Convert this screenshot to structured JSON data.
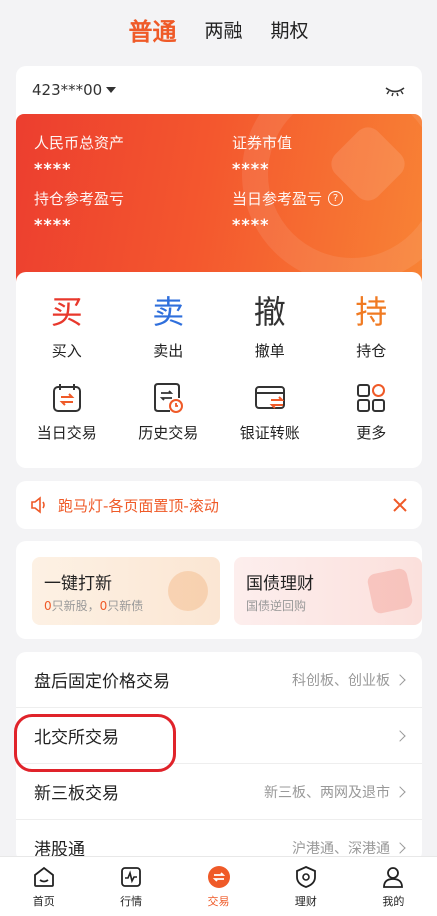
{
  "top_tabs": [
    "普通",
    "两融",
    "期权"
  ],
  "account": {
    "number": "423***00"
  },
  "assets": {
    "total_label": "人民币总资产",
    "total_value": "****",
    "market_label": "证券市值",
    "market_value": "****",
    "position_pl_label": "持仓参考盈亏",
    "position_pl_value": "****",
    "day_pl_label": "当日参考盈亏",
    "day_pl_value": "****",
    "help": "?"
  },
  "trade_buttons": [
    {
      "char": "买",
      "label": "买入",
      "color": "#e8382c"
    },
    {
      "char": "卖",
      "label": "卖出",
      "color": "#2f6fdc"
    },
    {
      "char": "撤",
      "label": "撤单",
      "color": "#333333"
    },
    {
      "char": "持",
      "label": "持仓",
      "color": "#f07a22"
    }
  ],
  "tools": [
    "当日交易",
    "历史交易",
    "银证转账",
    "更多"
  ],
  "marquee": {
    "text": "跑马灯-各页面置顶-滚动"
  },
  "promo": {
    "ipo": {
      "title": "一键打新",
      "count1": "0",
      "text1": "只新股，",
      "count2": "0",
      "text2": "只新债"
    },
    "bond": {
      "title": "国债理财",
      "sub": "国债逆回购"
    }
  },
  "list_items": [
    {
      "name": "盘后固定价格交易",
      "right": "科创板、创业板"
    },
    {
      "name": "北交所交易",
      "right": ""
    },
    {
      "name": "新三板交易",
      "right": "新三板、两网及退市"
    },
    {
      "name": "港股通",
      "right": "沪港通、深港通"
    }
  ],
  "bottom_tabs": [
    "首页",
    "行情",
    "交易",
    "理财",
    "我的"
  ],
  "colors": {
    "accent": "#ef5a28",
    "highlight": "#e0232a"
  }
}
